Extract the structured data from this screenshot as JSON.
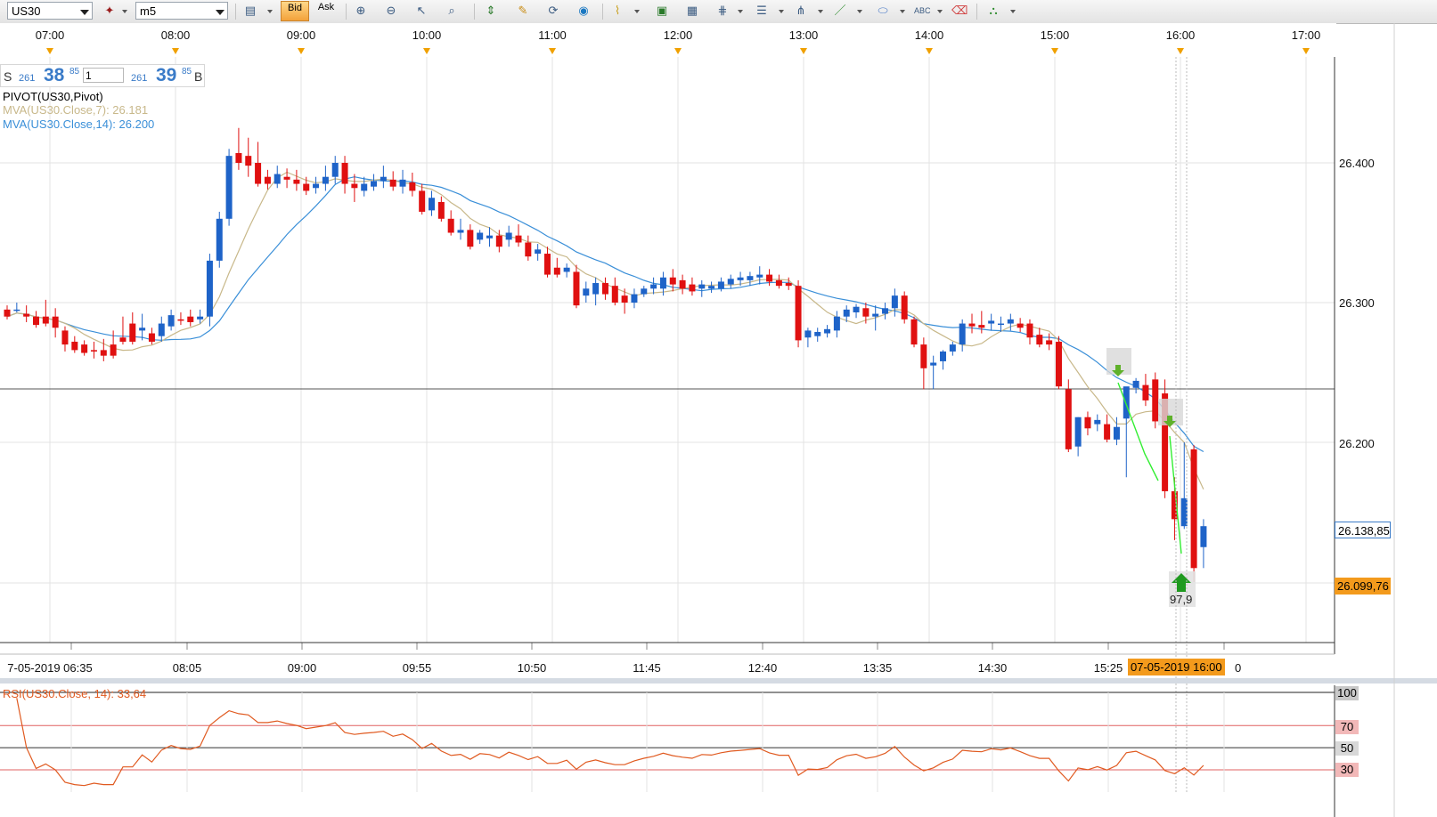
{
  "toolbar": {
    "symbol": "US30",
    "timeframe": "m5",
    "bid_label": "Bid",
    "ask_label": "Ask"
  },
  "time_axis_top": {
    "labels": [
      "07:00",
      "08:00",
      "09:00",
      "10:00",
      "11:00",
      "12:00",
      "13:00",
      "14:00",
      "15:00",
      "16:00",
      "17:00"
    ]
  },
  "time_axis_bottom": {
    "labels": [
      "7-05-2019 06:35",
      "08:05",
      "09:00",
      "09:55",
      "10:50",
      "11:45",
      "12:40",
      "13:35",
      "14:30",
      "15:25"
    ],
    "current_time": "07-05-2019 16:00",
    "current_time_tail": "0"
  },
  "price_panel": {
    "sell_letter": "S",
    "sell_small": "261",
    "sell_big": "38",
    "sell_sup": "85",
    "qty": "1",
    "buy_small": "261",
    "buy_big": "39",
    "buy_sup": "85",
    "buy_letter": "B"
  },
  "indicators": {
    "pivot": "PIVOT(US30,Pivot)",
    "mva7": "MVA(US30.Close,7): 26.181",
    "mva14": "MVA(US30.Close,14): 26.200",
    "mva7_color": "#c8b88a",
    "mva14_color": "#3a8fd8"
  },
  "price_axis": {
    "labels": [
      "26.400",
      "26.300",
      "26.200"
    ],
    "current_price": "26.138,85",
    "marker_price": "26.099,76"
  },
  "signal": {
    "label": "97,9"
  },
  "rsi": {
    "title": "RSI(US30.Close, 14): 33,64",
    "levels": [
      "100",
      "70",
      "50",
      "30"
    ]
  },
  "colors": {
    "bull": "#1e63c8",
    "bear": "#e01010",
    "orange": "#f39a1c"
  }
}
